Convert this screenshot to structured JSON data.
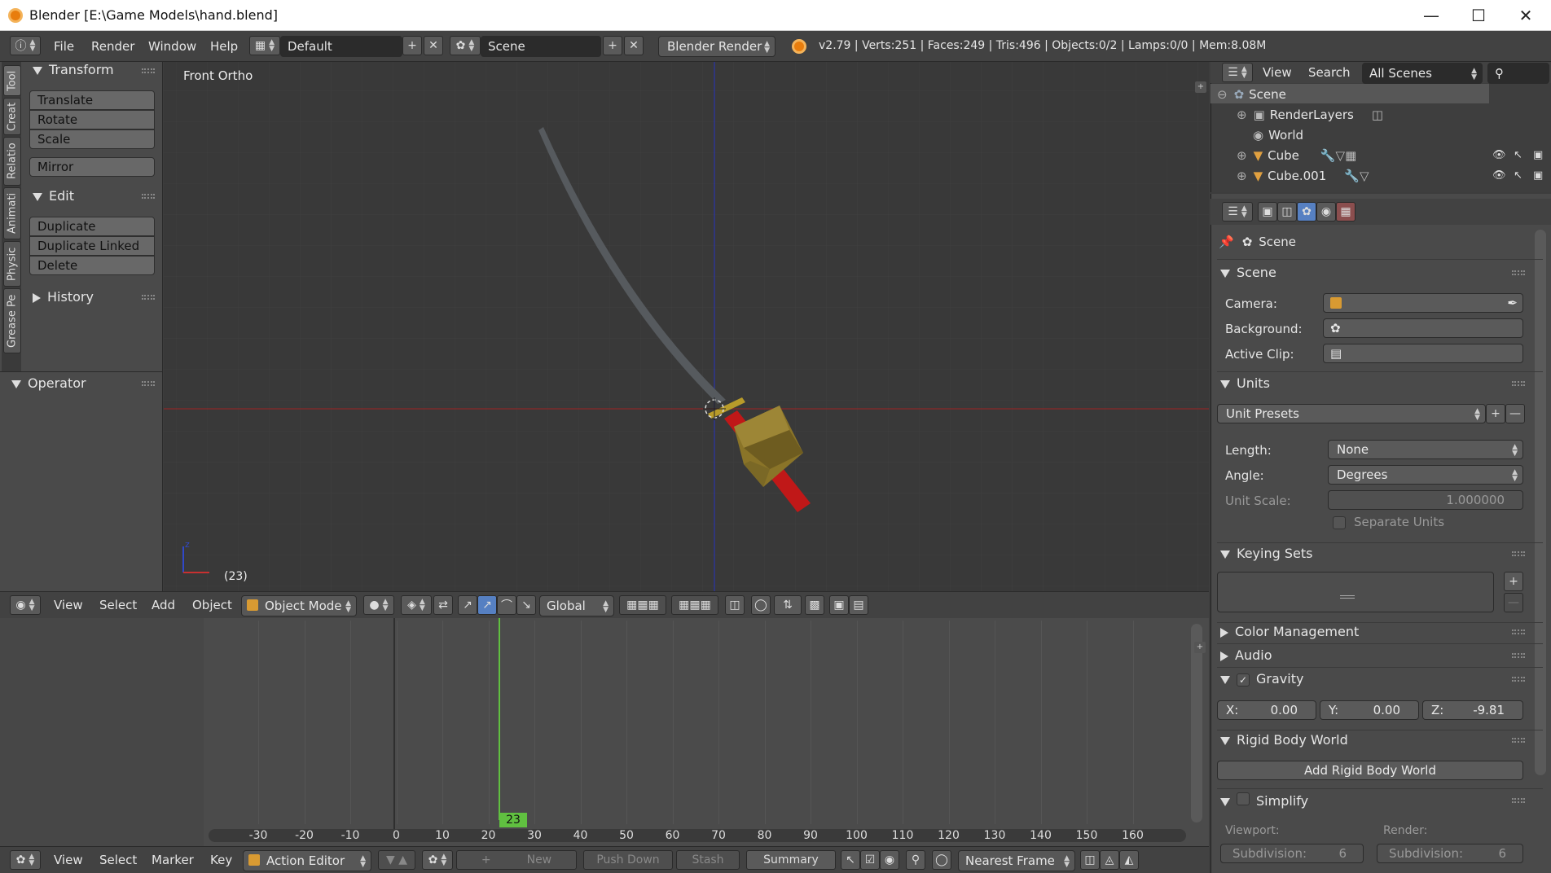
{
  "window": {
    "title": "Blender [E:\\Game Models\\hand.blend]"
  },
  "info_header": {
    "menus": [
      "File",
      "Render",
      "Window",
      "Help"
    ],
    "layout_name": "Default",
    "scene_name": "Scene",
    "render_engine": "Blender Render",
    "stats": "v2.79 | Verts:251 | Faces:249 | Tris:496 | Objects:0/2 | Lamps:0/0 | Mem:8.08M"
  },
  "tool_tabs": [
    "Tool",
    "Creat",
    "Relatio",
    "Animati",
    "Physic",
    "Grease Pe"
  ],
  "tool_shelf": {
    "transform_title": "Transform",
    "transform_buttons": [
      "Translate",
      "Rotate",
      "Scale"
    ],
    "mirror_button": "Mirror",
    "edit_title": "Edit",
    "edit_buttons": [
      "Duplicate",
      "Duplicate Linked",
      "Delete"
    ],
    "history_title": "History",
    "operator_title": "Operator"
  },
  "viewport": {
    "view_label": "Front Ortho",
    "frame_label": "(23)"
  },
  "viewport_header": {
    "menus": [
      "View",
      "Select",
      "Add",
      "Object"
    ],
    "mode": "Object Mode",
    "orientation": "Global"
  },
  "timeline": {
    "ticks": [
      "-30",
      "-20",
      "-10",
      "0",
      "10",
      "20",
      "30",
      "40",
      "50",
      "60",
      "70",
      "80",
      "90",
      "100",
      "110",
      "120",
      "130",
      "140",
      "150",
      "160"
    ],
    "current_frame": "23"
  },
  "timeline_header": {
    "menus": [
      "View",
      "Select",
      "Marker",
      "Key"
    ],
    "editor_mode": "Action Editor",
    "new_label": "New",
    "push_down": "Push Down",
    "stash": "Stash",
    "summary": "Summary",
    "snap": "Nearest Frame"
  },
  "outliner": {
    "menus": [
      "View",
      "Search"
    ],
    "filter": "All Scenes",
    "items": [
      "Scene",
      "RenderLayers",
      "World",
      "Cube",
      "Cube.001"
    ]
  },
  "properties": {
    "context": "Scene",
    "scene_panel": "Scene",
    "camera_label": "Camera:",
    "background_label": "Background:",
    "active_clip_label": "Active Clip:",
    "units_panel": "Units",
    "unit_presets": "Unit Presets",
    "length_label": "Length:",
    "length_value": "None",
    "angle_label": "Angle:",
    "angle_value": "Degrees",
    "unit_scale_label": "Unit Scale:",
    "unit_scale_value": "1.000000",
    "separate_units": "Separate Units",
    "keying_sets_panel": "Keying Sets",
    "color_management": "Color Management",
    "audio": "Audio",
    "gravity": "Gravity",
    "gravity_x_label": "X:",
    "gravity_x": "0.00",
    "gravity_y_label": "Y:",
    "gravity_y": "0.00",
    "gravity_z_label": "Z:",
    "gravity_z": "-9.81",
    "rigid_body_world": "Rigid Body World",
    "add_rigid_body_world": "Add Rigid Body World",
    "simplify": "Simplify",
    "viewport_label": "Viewport:",
    "render_label": "Render:",
    "subdivision_label": "Subdivision:",
    "viewport_subdiv": "6",
    "render_subdiv": "6"
  },
  "colors": {
    "accent": "#5680c2",
    "frame_cursor": "#60c040",
    "red_axis": "#a02020",
    "blue_axis": "#2030a0"
  }
}
